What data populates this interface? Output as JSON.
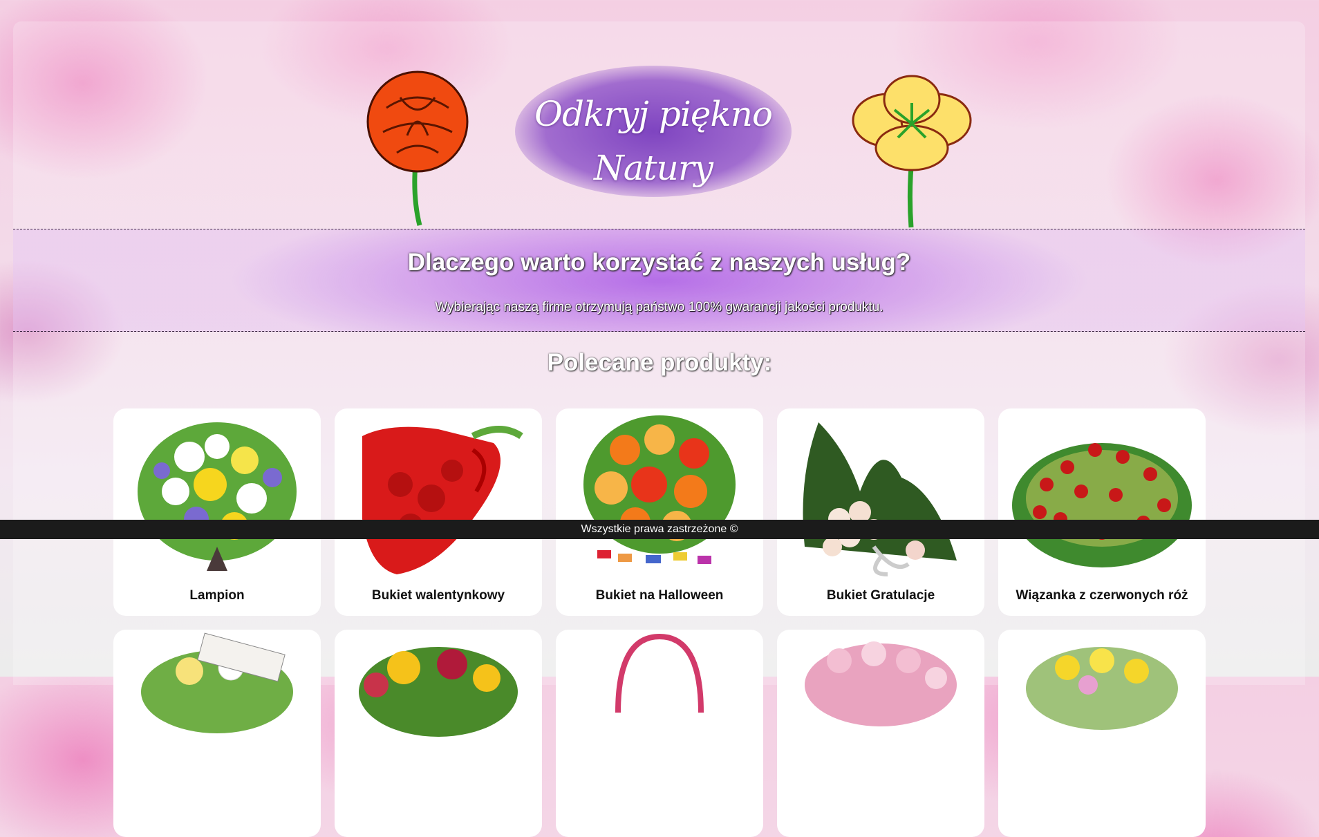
{
  "header": {
    "logo_line1": "Odkryj piękno",
    "logo_line2": "Natury"
  },
  "why": {
    "title": "Dlaczego warto korzystać z naszych usług?",
    "text": "Wybierając naszą firme otrzymują państwo 100% gwarancji jakości produktu."
  },
  "products": {
    "title": "Polecane produkty:",
    "items": [
      {
        "name": "Lampion"
      },
      {
        "name": "Bukiet walentynkowy"
      },
      {
        "name": "Bukiet na Halloween"
      },
      {
        "name": "Bukiet Gratulacje"
      },
      {
        "name": "Wiązanka z czerwonych róż"
      }
    ]
  },
  "footer": {
    "copyright": "Wszystkie prawa zastrzeżone ©"
  },
  "colors": {
    "accent_purple": "#8c50c8",
    "footer_bg": "#1b1b1b",
    "card_bg": "#ffffff"
  }
}
